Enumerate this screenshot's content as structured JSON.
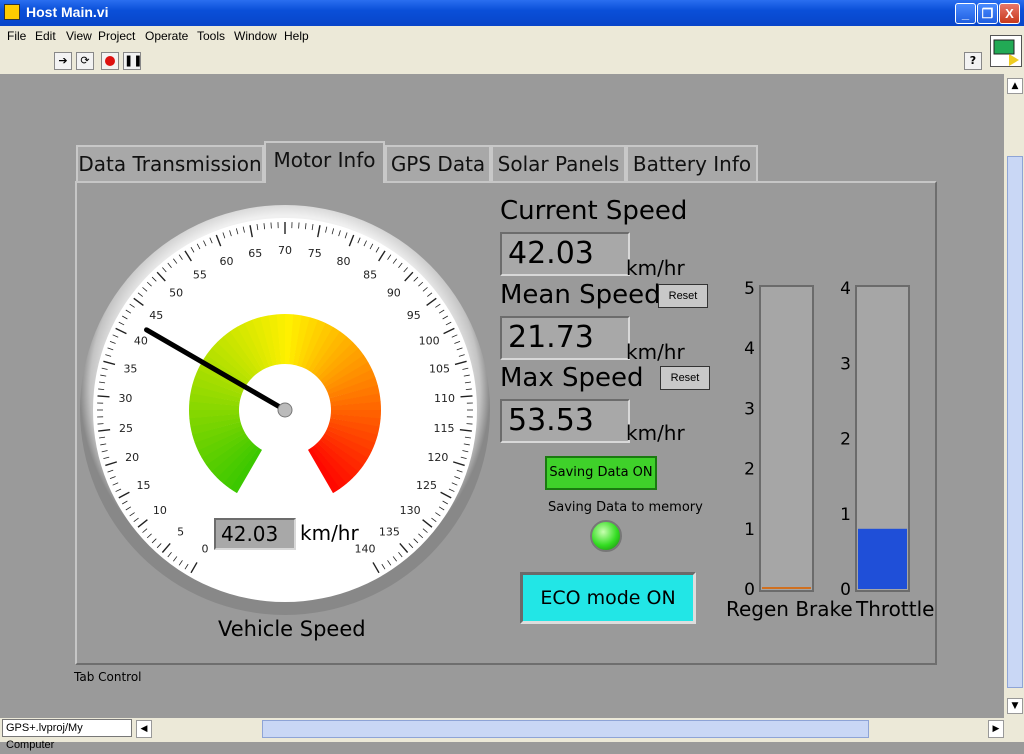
{
  "window": {
    "title": "Host Main.vi",
    "minimize": "_",
    "maximize": "❐",
    "close": "X"
  },
  "menu": [
    "File",
    "Edit",
    "View",
    "Project",
    "Operate",
    "Tools",
    "Window",
    "Help"
  ],
  "toolbar": {
    "help": "?"
  },
  "tabs": [
    "Data Transmission",
    "Motor Info",
    "GPS Data",
    "Solar Panels",
    "Battery Info"
  ],
  "tab_control_label": "Tab Control",
  "speedometer": {
    "ticks": [
      "0",
      "5",
      "10",
      "15",
      "20",
      "25",
      "30",
      "35",
      "40",
      "45",
      "50",
      "55",
      "60",
      "65",
      "70",
      "75",
      "80",
      "85",
      "90",
      "95",
      "100",
      "105",
      "110",
      "115",
      "120",
      "125",
      "130",
      "135",
      "140"
    ],
    "value": 42.03,
    "readout": "42.03",
    "unit": "km/hr",
    "label": "Vehicle Speed",
    "min": 0,
    "max": 140
  },
  "current_speed": {
    "label": "Current Speed",
    "value": "42.03",
    "unit": "km/hr"
  },
  "mean_speed": {
    "label": "Mean Speed",
    "value": "21.73",
    "unit": "km/hr",
    "reset": "Reset"
  },
  "max_speed": {
    "label": "Max Speed",
    "value": "53.53",
    "unit": "km/hr",
    "reset": "Reset"
  },
  "saving": {
    "button": "Saving Data ON",
    "label": "Saving Data to memory",
    "led_color": "#33dd22"
  },
  "eco": {
    "button": "ECO mode ON",
    "color": "#22e6e6"
  },
  "regen": {
    "label": "Regen Brake",
    "ticks": [
      "5",
      "4",
      "3",
      "2",
      "1",
      "0"
    ],
    "value": 0,
    "max": 5
  },
  "throttle": {
    "label": "Throttle",
    "ticks": [
      "4",
      "3",
      "2",
      "1",
      "0"
    ],
    "value": 0.8,
    "max": 4,
    "color": "#1f4fd8"
  },
  "status": {
    "project_path": "GPS+.lvproj/My Computer"
  }
}
